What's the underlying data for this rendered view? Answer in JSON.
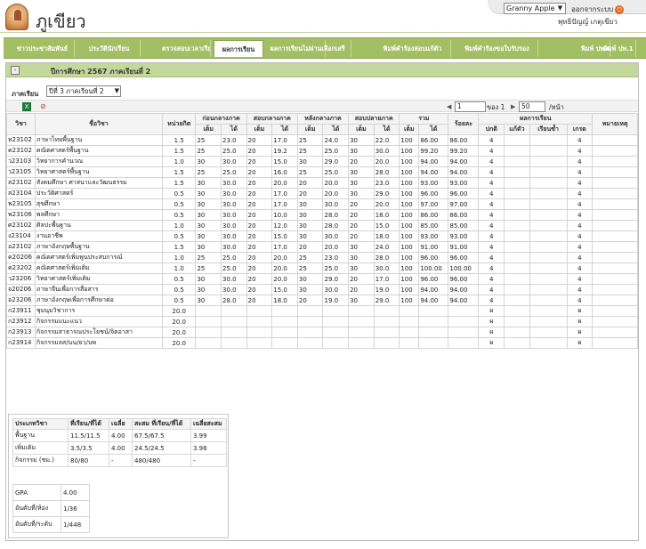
{
  "app": {
    "brand": "ภูเขียว"
  },
  "topbar": {
    "theme_value": "Granny Apple",
    "logout_label": "ออกจากระบบ",
    "username": "พุทธิปัญญ์ เกตุเขียว"
  },
  "nav": [
    "ข่าวประชาสัมพันธ์",
    "ประวัตินักเรียน",
    "ตรวจสอบเวลาเรียน",
    "ผลการเรียน",
    "ผลการเรียนไม่ผ่าน",
    "เลือกเสรี",
    "พิมพ์คำร้องสอบแก้ตัว",
    "พิมพ์คำร้องขอใบรับรอง",
    "พิมพ์ ปพ.6",
    "พิมพ์ ปพ.1"
  ],
  "panel": {
    "title": "ปีการศึกษา 2567 ภาคเรียนที่ 2",
    "semester_label": "ภาคเรียน",
    "semester_value": "ปีที่ 3 ภาคเรียนที่ 2",
    "pager": {
      "page": "1",
      "of_label": "ของ 1",
      "per_page": "50",
      "per_page_label": "/หน้า"
    }
  },
  "table": {
    "headers": {
      "code": "วิชา",
      "name": "ชื่อวิชา",
      "credit": "หน่วยกิต",
      "mid1": "ก่อนกลางภาค",
      "mid": "สอบกลางภาค",
      "post": "หลังกลางภาค",
      "final": "สอบปลายภาค",
      "total": "รวม",
      "percent": "ร้อยละ",
      "result": "ผลการเรียน",
      "note": "หมายเหตุ",
      "full": "เต็ม",
      "got": "ได้",
      "normal": "ปกติ",
      "fix": "แก้ตัว",
      "repeat": "เรียนซ้ำ",
      "grade": "เกรด"
    },
    "rows": [
      [
        "ท23102",
        "ภาษาไทยพื้นฐาน",
        "1.5",
        "25",
        "23.0",
        "20",
        "17.0",
        "25",
        "24.0",
        "30",
        "22.0",
        "100",
        "86.00",
        "86.00",
        "4",
        "",
        "",
        "4",
        ""
      ],
      [
        "ค23102",
        "คณิตศาสตร์พื้นฐาน",
        "1.5",
        "25",
        "25.0",
        "20",
        "19.2",
        "25",
        "25.0",
        "30",
        "30.0",
        "100",
        "99.20",
        "99.20",
        "4",
        "",
        "",
        "4",
        ""
      ],
      [
        "ว23103",
        "วิทยาการคำนวณ",
        "1.0",
        "30",
        "30.0",
        "20",
        "15.0",
        "30",
        "29.0",
        "20",
        "20.0",
        "100",
        "94.00",
        "94.00",
        "4",
        "",
        "",
        "4",
        ""
      ],
      [
        "ว23105",
        "วิทยาศาสตร์พื้นฐาน",
        "1.5",
        "25",
        "25.0",
        "20",
        "16.0",
        "25",
        "25.0",
        "30",
        "28.0",
        "100",
        "94.00",
        "94.00",
        "4",
        "",
        "",
        "4",
        ""
      ],
      [
        "ส23102",
        "สังคมศึกษา ศาสนาและวัฒนธรรม",
        "1.5",
        "30",
        "30.0",
        "20",
        "20.0",
        "20",
        "20.0",
        "30",
        "23.0",
        "100",
        "93.00",
        "93.00",
        "4",
        "",
        "",
        "4",
        ""
      ],
      [
        "ส23104",
        "ประวัติศาสตร์",
        "0.5",
        "30",
        "30.0",
        "20",
        "17.0",
        "20",
        "20.0",
        "30",
        "29.0",
        "100",
        "96.00",
        "96.00",
        "4",
        "",
        "",
        "4",
        ""
      ],
      [
        "พ23105",
        "สุขศึกษา",
        "0.5",
        "30",
        "30.0",
        "20",
        "17.0",
        "30",
        "30.0",
        "20",
        "20.0",
        "100",
        "97.00",
        "97.00",
        "4",
        "",
        "",
        "4",
        ""
      ],
      [
        "พ23106",
        "พลศึกษา",
        "0.5",
        "30",
        "30.0",
        "20",
        "10.0",
        "30",
        "28.0",
        "20",
        "18.0",
        "100",
        "86.00",
        "86.00",
        "4",
        "",
        "",
        "4",
        ""
      ],
      [
        "ศ23102",
        "ศิลปะพื้นฐาน",
        "1.0",
        "30",
        "30.0",
        "20",
        "12.0",
        "30",
        "28.0",
        "20",
        "15.0",
        "100",
        "85.00",
        "85.00",
        "4",
        "",
        "",
        "4",
        ""
      ],
      [
        "ง23104",
        "งานอาชีพ",
        "0.5",
        "30",
        "30.0",
        "20",
        "15.0",
        "30",
        "30.0",
        "20",
        "18.0",
        "100",
        "93.00",
        "93.00",
        "4",
        "",
        "",
        "4",
        ""
      ],
      [
        "อ23102",
        "ภาษาอังกฤษพื้นฐาน",
        "1.5",
        "30",
        "30.0",
        "20",
        "17.0",
        "20",
        "20.0",
        "30",
        "24.0",
        "100",
        "91.00",
        "91.00",
        "4",
        "",
        "",
        "4",
        ""
      ],
      [
        "ค20206",
        "คณิตศาสตร์เพิ่มพูนประสบการณ์",
        "1.0",
        "25",
        "25.0",
        "20",
        "20.0",
        "25",
        "23.0",
        "30",
        "28.0",
        "100",
        "96.00",
        "96.00",
        "4",
        "",
        "",
        "4",
        ""
      ],
      [
        "ค23202",
        "คณิตศาสตร์เพิ่มเติม",
        "1.0",
        "25",
        "25.0",
        "20",
        "20.0",
        "25",
        "25.0",
        "30",
        "30.0",
        "100",
        "100.00",
        "100.00",
        "4",
        "",
        "",
        "4",
        ""
      ],
      [
        "ว23206",
        "วิทยาศาสตร์เพิ่มเติม",
        "0.5",
        "30",
        "30.0",
        "20",
        "20.0",
        "30",
        "29.0",
        "20",
        "17.0",
        "100",
        "96.00",
        "96.00",
        "4",
        "",
        "",
        "4",
        ""
      ],
      [
        "จ20206",
        "ภาษาจีนเพื่อการสื่อสาร",
        "0.5",
        "30",
        "30.0",
        "20",
        "15.0",
        "30",
        "30.0",
        "20",
        "19.0",
        "100",
        "94.00",
        "94.00",
        "4",
        "",
        "",
        "4",
        ""
      ],
      [
        "อ23206",
        "ภาษาอังกฤษเพื่อการศึกษาต่อ",
        "0.5",
        "30",
        "28.0",
        "20",
        "18.0",
        "20",
        "19.0",
        "30",
        "29.0",
        "100",
        "94.00",
        "94.00",
        "4",
        "",
        "",
        "4",
        ""
      ],
      [
        "ก23911",
        "ชุมนุมวิชาการ",
        "20.0",
        "",
        "",
        "",
        "",
        "",
        "",
        "",
        "",
        "",
        "",
        "",
        "ผ",
        "",
        "",
        "ผ",
        ""
      ],
      [
        "ก23912",
        "กิจกรรมแนะแนว",
        "20.0",
        "",
        "",
        "",
        "",
        "",
        "",
        "",
        "",
        "",
        "",
        "",
        "ผ",
        "",
        "",
        "ผ",
        ""
      ],
      [
        "ก23913",
        "กิจกรรมสาธารณประโยชน์/จิตอาสา",
        "20.0",
        "",
        "",
        "",
        "",
        "",
        "",
        "",
        "",
        "",
        "",
        "",
        "ผ",
        "",
        "",
        "ผ",
        ""
      ],
      [
        "ก23914",
        "กิจกรรมลส/นน/ยว/บพ",
        "20.0",
        "",
        "",
        "",
        "",
        "",
        "",
        "",
        "",
        "",
        "",
        "",
        "ผ",
        "",
        "",
        "ผ",
        ""
      ]
    ]
  },
  "summary": {
    "headers": [
      "ประเภทวิชา",
      "ที่เรียน/ที่ได้",
      "เฉลี่ย",
      "สะสม ที่เรียน/ที่ได้",
      "เฉลี่ยสะสม"
    ],
    "rows": [
      [
        "พื้นฐาน",
        "11.5/11.5",
        "4.00",
        "67.5/67.5",
        "3.99"
      ],
      [
        "เพิ่มเติม",
        "3.5/3.5",
        "4.00",
        "24.5/24.5",
        "3.98"
      ],
      [
        "กิจกรรม (ชม.)",
        "80/80",
        "-",
        "480/480",
        "-"
      ]
    ],
    "gpa": [
      [
        "GPA",
        "4.00"
      ],
      [
        "อันดับที่/ห้อง",
        "1/36"
      ],
      [
        "อันดับที่/ระดับ",
        "1/448"
      ]
    ]
  }
}
